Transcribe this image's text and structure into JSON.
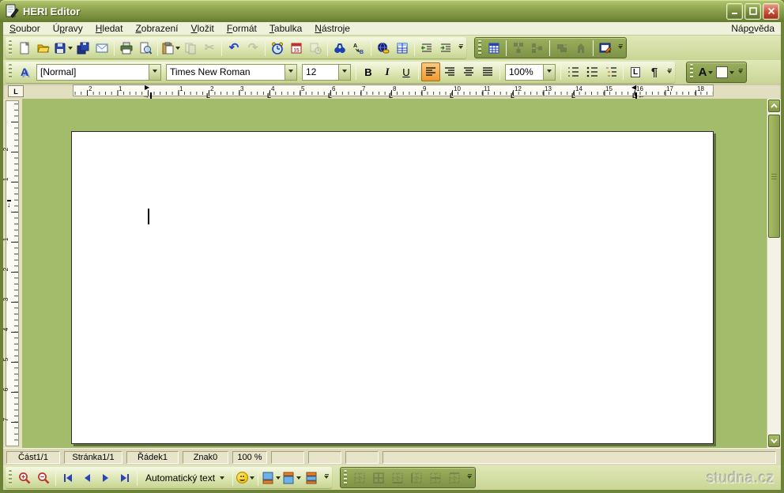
{
  "window": {
    "title": "HERI Editor",
    "watermark": "studna.cz"
  },
  "menubar": {
    "items": [
      {
        "pre": "",
        "key": "S",
        "post": "oubor"
      },
      {
        "pre": "Ú",
        "key": "p",
        "post": "ravy"
      },
      {
        "pre": "",
        "key": "H",
        "post": "ledat"
      },
      {
        "pre": "",
        "key": "Z",
        "post": "obrazení"
      },
      {
        "pre": "",
        "key": "V",
        "post": "ložit"
      },
      {
        "pre": "",
        "key": "F",
        "post": "ormát"
      },
      {
        "pre": "",
        "key": "T",
        "post": "abulka"
      },
      {
        "pre": "",
        "key": "N",
        "post": "ástroje"
      }
    ],
    "help": {
      "pre": "Náp",
      "key": "o",
      "post": "věda"
    }
  },
  "toolbar_main": {
    "calendar_day": "15",
    "replace_from": "A",
    "replace_to": "B"
  },
  "format_bar": {
    "style_value": "[Normal]",
    "font_value": "Times New Roman",
    "size_value": "12",
    "zoom_value": "100%",
    "bold": "B",
    "italic": "I",
    "underline": "U",
    "tab_box": "L",
    "pilcrow": "¶",
    "font_color": "A",
    "styles_icon_letter": "A"
  },
  "glyphs": {
    "undo": "↶",
    "redo": "↷",
    "cut": "✂",
    "ruler_marker_left": "▶",
    "ruler_marker_right": "◀",
    "ruler_marker_down": "↓",
    "arrow_right": "→",
    "arrow_left": "←",
    "tab_stop": "L"
  },
  "icons": {
    "new-document-icon": "blank-page-shape",
    "open-icon": "folder-shape",
    "save-icon": "floppy-shape",
    "save-all-icon": "double-floppy-shape",
    "email-icon": "envelope-shape",
    "print-icon": "printer-shape",
    "print-preview-icon": "page-magnifier-shape",
    "paste-icon": "clipboard-shape",
    "copy-icon": "two-pages-shape",
    "find-icon": "binoculars-shape",
    "hyperlink-icon": "globe-chain-shape",
    "table-icon": "grid-shape",
    "zoom-in-icon": "magnifier-plus-shape",
    "zoom-out-icon": "magnifier-minus-shape",
    "smiley-icon": "smiley-face"
  },
  "ruler": {
    "h": [
      "2",
      "1",
      "1",
      "2",
      "3",
      "4",
      "5",
      "6",
      "7",
      "8",
      "9",
      "10",
      "11",
      "12",
      "13",
      "14",
      "15",
      "16",
      "17",
      "18"
    ],
    "v": [
      "2",
      "1",
      "1",
      "2",
      "3",
      "4",
      "5",
      "6",
      "7"
    ]
  },
  "status": {
    "section": "Část1/1",
    "page": "Stránka1/1",
    "line": "Řádek1",
    "char": "Znak0",
    "zoom": "100 %"
  },
  "bottom": {
    "autotext": "Automatický text"
  },
  "colors": {
    "workspace_green": "#a2bc6b",
    "selected_orange": "#ef9a2e",
    "titlebar_olive": "#7b9140",
    "close_red": "#c94f35"
  }
}
